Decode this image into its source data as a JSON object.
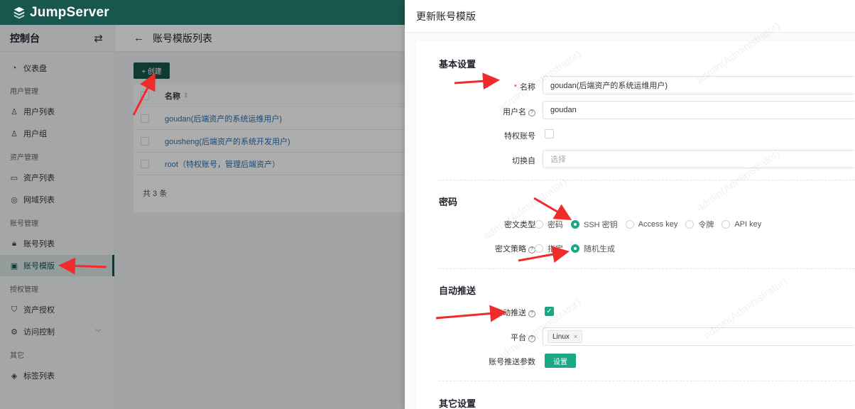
{
  "brand": {
    "name": "JumpServer"
  },
  "sidebar": {
    "title": "控制台",
    "switch_icon": "⇄",
    "groups": {
      "user": "用户管理",
      "asset": "资产管理",
      "account": "账号管理",
      "perm": "授权管理",
      "other": "其它"
    },
    "items": {
      "dashboard": "仪表盘",
      "users": "用户列表",
      "user_groups": "用户组",
      "assets": "资产列表",
      "domains": "网域列表",
      "accounts": "账号列表",
      "templates": "账号模版",
      "asset_perm": "资产授权",
      "acl": "访问控制",
      "labels": "标签列表"
    }
  },
  "main": {
    "title": "账号模版列表",
    "create_label": "+ 创建",
    "column_name": "名称",
    "rows": [
      "goudan(后端资产的系统运维用户)",
      "gousheng(后端资产的系统开发用户)",
      "root（特权账号，管理后端资产）"
    ],
    "total": "共 3 条"
  },
  "drawer": {
    "title": "更新账号模版",
    "basic": {
      "section": "基本设置",
      "name_label": "名称",
      "name_value": "goudan(后端资产的系统运维用户)",
      "username_label": "用户名",
      "username_value": "goudan",
      "privileged_label": "特权账号",
      "su_from_label": "切换自",
      "su_from_placeholder": "选择"
    },
    "secret": {
      "section": "密码",
      "type_label": "密文类型",
      "type_options": [
        "密码",
        "SSH 密钥",
        "Access key",
        "令牌",
        "API key"
      ],
      "type_selected": "SSH 密钥",
      "strategy_label": "密文策略",
      "strategy_options": [
        "指定",
        "随机生成"
      ],
      "strategy_selected": "随机生成"
    },
    "push": {
      "section": "自动推送",
      "auto_push_label": "自动推送",
      "auto_push_checked": true,
      "platform_label": "平台",
      "platform_tag": "Linux",
      "params_label": "账号推送参数",
      "params_button": "设置"
    },
    "other": {
      "section": "其它设置"
    }
  },
  "watermark": "admin(Administrator)",
  "colors": {
    "brand": "#17574d",
    "accent": "#1ba784",
    "link": "#2a6fb2"
  }
}
